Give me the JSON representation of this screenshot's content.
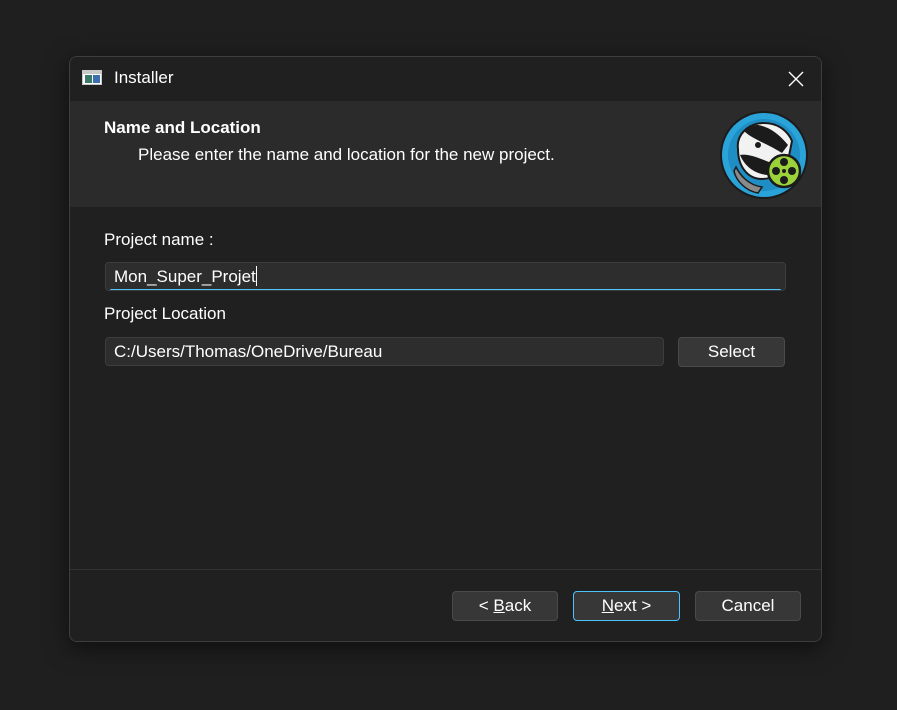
{
  "window": {
    "title": "Installer"
  },
  "header": {
    "title": "Name and Location",
    "subtitle": "Please enter the name and location for the new project.",
    "logo_icon": "badger-film-logo-icon"
  },
  "form": {
    "project_name_label": "Project name :",
    "project_name_value": "Mon_Super_Projet",
    "project_location_label": "Project Location",
    "project_location_value": "C:/Users/Thomas/OneDrive/Bureau",
    "select_button_label": "Select"
  },
  "footer": {
    "back_prefix": "< ",
    "back_accel": "B",
    "back_rest": "ack",
    "next_accel": "N",
    "next_rest": "ext >",
    "cancel_label": "Cancel"
  },
  "colors": {
    "accent": "#4cc2ff",
    "background": "#202020",
    "header_background": "#2b2b2b"
  }
}
